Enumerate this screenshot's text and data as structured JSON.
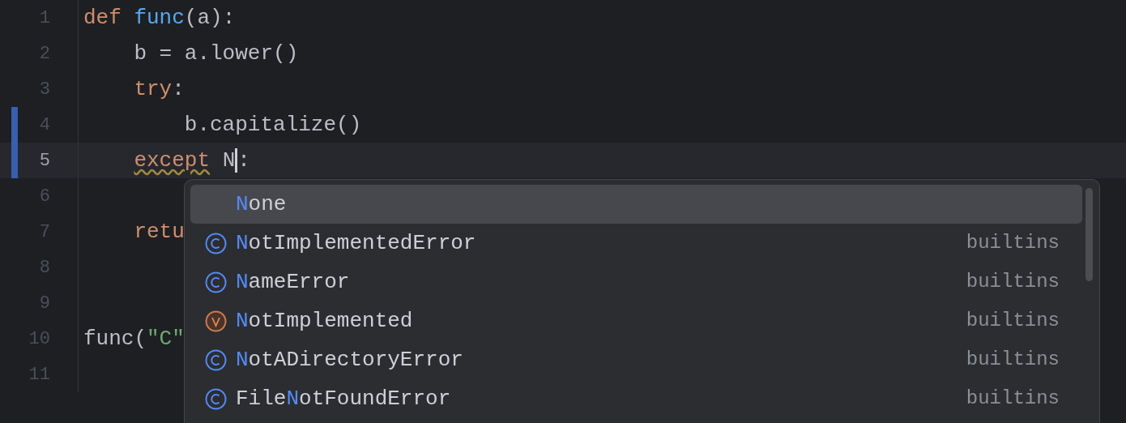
{
  "editor": {
    "lines": [
      {
        "number": "1",
        "current": false,
        "changed": false,
        "tokens": [
          {
            "kind": "keyword",
            "text": "def"
          },
          {
            "kind": "function",
            "text": " func"
          },
          {
            "kind": "plain",
            "text": "(a):"
          }
        ]
      },
      {
        "number": "2",
        "current": false,
        "changed": false,
        "tokens": [
          {
            "kind": "indent"
          },
          {
            "kind": "plain",
            "text": "b = a.lower()"
          }
        ]
      },
      {
        "number": "3",
        "current": false,
        "changed": false,
        "tokens": [
          {
            "kind": "indent"
          },
          {
            "kind": "keyword",
            "text": "try"
          },
          {
            "kind": "plain",
            "text": ":"
          }
        ]
      },
      {
        "number": "4",
        "current": false,
        "changed": true,
        "tokens": [
          {
            "kind": "indent"
          },
          {
            "kind": "indent"
          },
          {
            "kind": "plain",
            "text": "b.capitalize()"
          }
        ]
      },
      {
        "number": "5",
        "current": true,
        "changed": true,
        "tokens": [
          {
            "kind": "indent"
          },
          {
            "kind": "keyword",
            "text": "except",
            "warning": true
          },
          {
            "kind": "plain",
            "text": " N"
          },
          {
            "kind": "cursor"
          },
          {
            "kind": "plain",
            "text": ":"
          }
        ]
      },
      {
        "number": "6",
        "current": false,
        "changed": false
      },
      {
        "number": "7",
        "current": false,
        "changed": false,
        "tokens": [
          {
            "kind": "indent"
          },
          {
            "kind": "keyword",
            "text": "retu"
          }
        ]
      },
      {
        "number": "8",
        "current": false,
        "changed": false
      },
      {
        "number": "9",
        "current": false,
        "changed": false
      },
      {
        "number": "10",
        "current": false,
        "changed": false,
        "tokens": [
          {
            "kind": "plain",
            "text": "func("
          },
          {
            "kind": "string",
            "text": "\"C\""
          }
        ]
      },
      {
        "number": "11",
        "current": false,
        "changed": false
      }
    ]
  },
  "completion": {
    "items": [
      {
        "kind": "keyword",
        "match": "N",
        "rest": "one",
        "selected": true
      },
      {
        "kind": "class",
        "match": "N",
        "rest": "otImplementedError",
        "source": "builtins",
        "selected": false
      },
      {
        "kind": "class",
        "match": "N",
        "rest": "ameError",
        "source": "builtins",
        "selected": false
      },
      {
        "kind": "variable",
        "match": "N",
        "rest": "otImplemented",
        "source": "builtins",
        "selected": false
      },
      {
        "kind": "class",
        "match": "N",
        "rest": "otADirectoryError",
        "source": "builtins",
        "selected": false
      },
      {
        "kind": "class",
        "prefix": "File",
        "match": "N",
        "rest": "otFoundError",
        "source": "builtins",
        "selected": false
      }
    ]
  }
}
